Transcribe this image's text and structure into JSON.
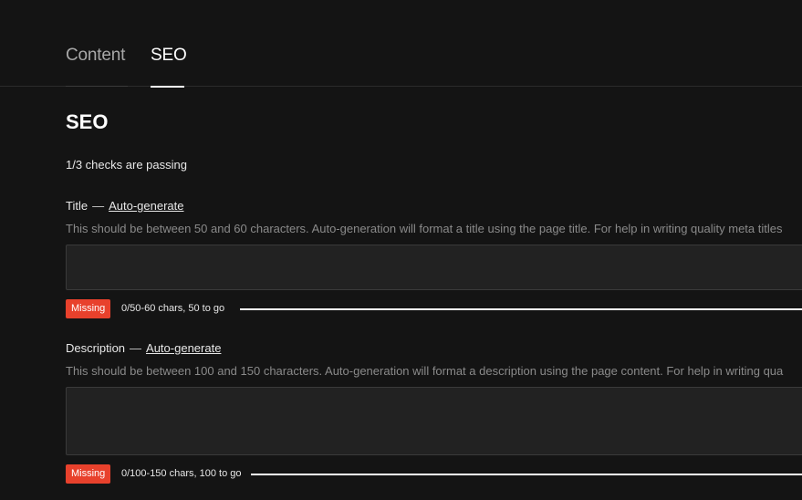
{
  "tabs": [
    {
      "label": "Content",
      "active": false
    },
    {
      "label": "SEO",
      "active": true
    }
  ],
  "section": {
    "title": "SEO",
    "summary": "1/3 checks are passing"
  },
  "fields": {
    "title": {
      "label": "Title",
      "separator": "—",
      "auto_generate": "Auto-generate",
      "hint": "This should be between 50 and 60 characters. Auto-generation will format a title using the page title. For help in writing quality meta titles",
      "value": "",
      "status": "Missing",
      "count": "0/50-60 chars, 50 to go",
      "progress": 0
    },
    "description": {
      "label": "Description",
      "separator": "—",
      "auto_generate": "Auto-generate",
      "hint": "This should be between 100 and 150 characters. Auto-generation will format a description using the page content. For help in writing qua",
      "value": "",
      "status": "Missing",
      "count": "0/100-150 chars, 100 to go",
      "progress": 0
    }
  },
  "colors": {
    "background": "#141414",
    "input_background": "#222222",
    "missing_badge": "#e8412c",
    "active_tab_underline": "#ffffff"
  }
}
